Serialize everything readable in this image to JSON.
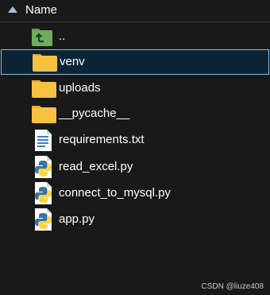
{
  "header": {
    "column_label": "Name",
    "sort_indicator": "sort-ascending-arrow-icon"
  },
  "files": [
    {
      "name": "..",
      "icon": "folder-up-icon",
      "selected": false
    },
    {
      "name": "venv",
      "icon": "folder-icon",
      "selected": true
    },
    {
      "name": "uploads",
      "icon": "folder-icon",
      "selected": false
    },
    {
      "name": "__pycache__",
      "icon": "folder-icon",
      "selected": false
    },
    {
      "name": "requirements.txt",
      "icon": "text-file-icon",
      "selected": false
    },
    {
      "name": "read_excel.py",
      "icon": "python-file-icon",
      "selected": false
    },
    {
      "name": "connect_to_mysql.py",
      "icon": "python-file-icon",
      "selected": false
    },
    {
      "name": "app.py",
      "icon": "python-file-icon",
      "selected": false
    }
  ],
  "watermark": "CSDN @liuze408",
  "colors": {
    "background": "#191919",
    "selection_fill": "#0c2536",
    "selection_border": "#8fb8d8",
    "folder": "#f5c242",
    "parent_folder": "#6fae5c",
    "python_blue": "#3773a5",
    "python_yellow": "#ffd43b"
  }
}
